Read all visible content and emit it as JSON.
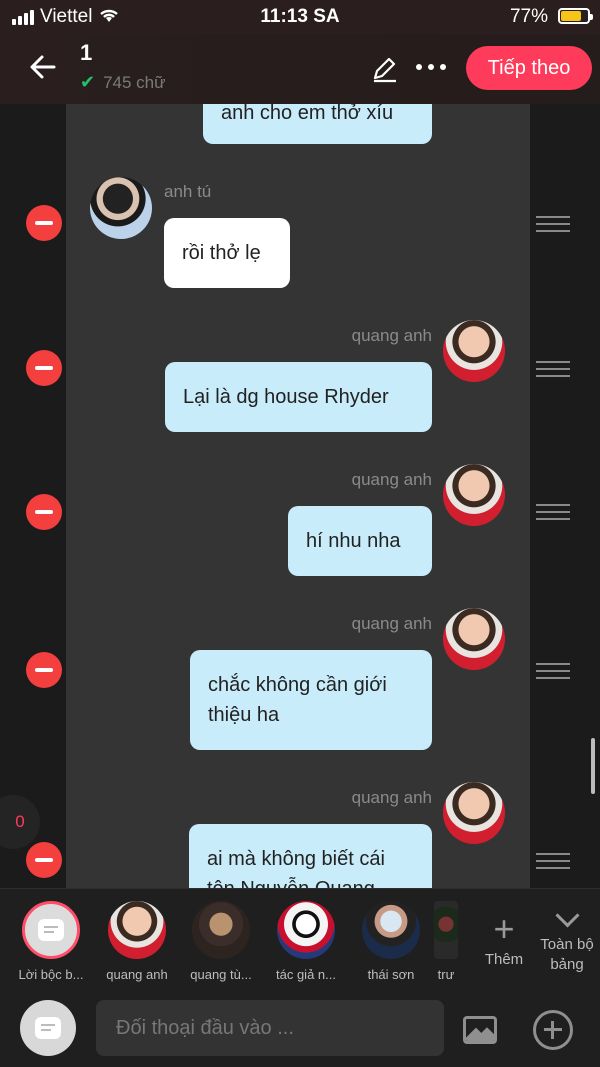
{
  "status_bar": {
    "carrier": "Viettel",
    "time": "11:13 SA",
    "battery": "77%"
  },
  "header": {
    "title": "1",
    "word_count": "745 chữ",
    "next_label": "Tiếp theo"
  },
  "messages": [
    {
      "side": "right",
      "sender": "",
      "text": "anh cho em thở xíu"
    },
    {
      "side": "left",
      "sender": "anh tú",
      "text": "rồi thở lẹ"
    },
    {
      "side": "right",
      "sender": "quang anh",
      "text": "Lại là dg house Rhyder"
    },
    {
      "side": "right",
      "sender": "quang anh",
      "text": "hí nhu nha"
    },
    {
      "side": "right",
      "sender": "quang anh",
      "text": "chắc không cần giới thiệu ha"
    },
    {
      "side": "right",
      "sender": "quang anh",
      "text": "ai mà không biết cái tên Nguyễn Quang"
    }
  ],
  "unread_count": "0",
  "characters": [
    {
      "label": "Lời bộc b...",
      "icon": "narrator-icon"
    },
    {
      "label": "quang anh",
      "icon": "avatar"
    },
    {
      "label": "quang tù...",
      "icon": "avatar"
    },
    {
      "label": "tác giả n...",
      "icon": "avatar"
    },
    {
      "label": "thái sơn",
      "icon": "avatar"
    },
    {
      "label": "trư",
      "icon": "avatar"
    }
  ],
  "add_character_label": "Thêm",
  "all_board_label": "Toàn bộ bảng",
  "input": {
    "placeholder": "Đối thoại đầu vào ..."
  }
}
